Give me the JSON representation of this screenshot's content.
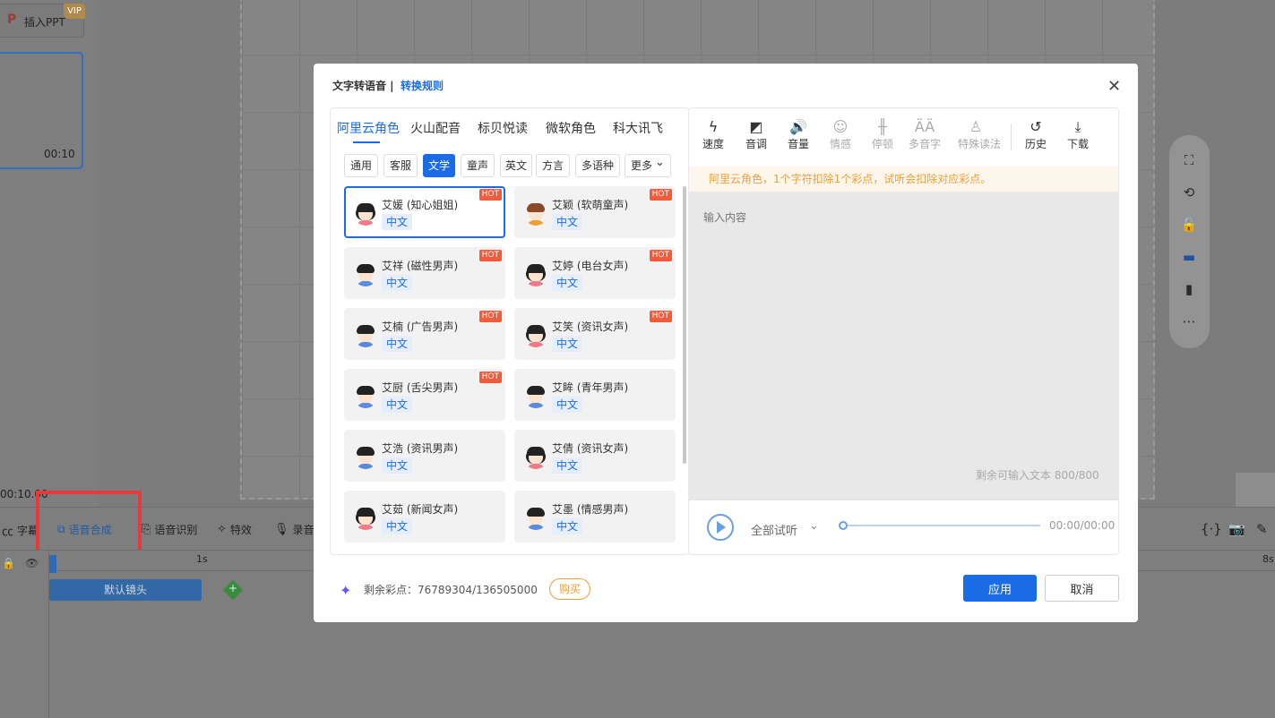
{
  "app": {
    "insert_ppt": "插入PPT",
    "vip_badge": "VIP",
    "thumb_time": "00:10",
    "current_time": "00:10.00",
    "canvas_caption": "默认镜头",
    "bottom_tabs": [
      "字幕",
      "语音合成",
      "语音识别",
      "特效",
      "录音"
    ],
    "timeline_marks": [
      "1s",
      "8s"
    ],
    "default_clip": "默认镜头"
  },
  "dialog": {
    "title": "文字转语音 |",
    "rules_link": "转换规则",
    "voice_tabs": [
      "阿里云角色",
      "火山配音",
      "标贝悦读",
      "微软角色",
      "科大讯飞"
    ],
    "active_voice_tab": "阿里云角色",
    "filters": [
      "通用",
      "客服",
      "文学",
      "童声",
      "英文",
      "方言",
      "多语种",
      "更多"
    ],
    "active_filter": "文学",
    "voices": [
      {
        "name": "艾媛 (知心姐姐)",
        "lang": "中文",
        "hot": "HOT",
        "gender": "female",
        "selected": true
      },
      {
        "name": "艾颖 (软萌童声)",
        "lang": "中文",
        "hot": "HOT",
        "gender": "child"
      },
      {
        "name": "艾祥 (磁性男声)",
        "lang": "中文",
        "hot": "HOT",
        "gender": "male"
      },
      {
        "name": "艾婷 (电台女声)",
        "lang": "中文",
        "hot": "HOT",
        "gender": "female"
      },
      {
        "name": "艾楠 (广告男声)",
        "lang": "中文",
        "hot": "HOT",
        "gender": "male"
      },
      {
        "name": "艾笑 (资讯女声)",
        "lang": "中文",
        "hot": "HOT",
        "gender": "female"
      },
      {
        "name": "艾厨 (舌尖男声)",
        "lang": "中文",
        "hot": "HOT",
        "gender": "male"
      },
      {
        "name": "艾眸 (青年男声)",
        "lang": "中文",
        "hot": "",
        "gender": "male"
      },
      {
        "name": "艾浩 (资讯男声)",
        "lang": "中文",
        "hot": "",
        "gender": "male"
      },
      {
        "name": "艾倩 (资讯女声)",
        "lang": "中文",
        "hot": "",
        "gender": "female"
      },
      {
        "name": "艾茹 (新闻女声)",
        "lang": "中文",
        "hot": "",
        "gender": "female"
      },
      {
        "name": "艾墨 (情感男声)",
        "lang": "中文",
        "hot": "",
        "gender": "male"
      }
    ],
    "tools": [
      {
        "label": "速度",
        "icon": "lightning-icon",
        "glyph": "ϟ",
        "disabled": false
      },
      {
        "label": "音调",
        "icon": "pitch-icon",
        "glyph": "◩",
        "disabled": false
      },
      {
        "label": "音量",
        "icon": "volume-icon",
        "glyph": "🔊",
        "disabled": false
      },
      {
        "label": "情感",
        "icon": "emotion-icon",
        "glyph": "☺",
        "disabled": true
      },
      {
        "label": "停顿",
        "icon": "pause-icon",
        "glyph": "╫",
        "disabled": true
      },
      {
        "label": "多音字",
        "icon": "polyphone-icon",
        "glyph": "ÄÄ",
        "disabled": true
      },
      {
        "label": "特殊读法",
        "icon": "special-read-icon",
        "glyph": "♙",
        "disabled": true
      },
      {
        "label": "历史",
        "icon": "history-icon",
        "glyph": "↺",
        "disabled": false
      },
      {
        "label": "下载",
        "icon": "download-icon",
        "glyph": "⤓",
        "disabled": false
      }
    ],
    "notice": "阿里云角色，1个字符扣除1个彩点，试听会扣除对应彩点。",
    "input_placeholder": "输入内容",
    "remaining_text": "剩余可输入文本  800/800",
    "preview_all": "全部试听",
    "play_time": "00:00/00:00",
    "credits": "剩余彩点：76789304/136505000",
    "buy": "购买",
    "apply": "应用",
    "cancel": "取消"
  }
}
